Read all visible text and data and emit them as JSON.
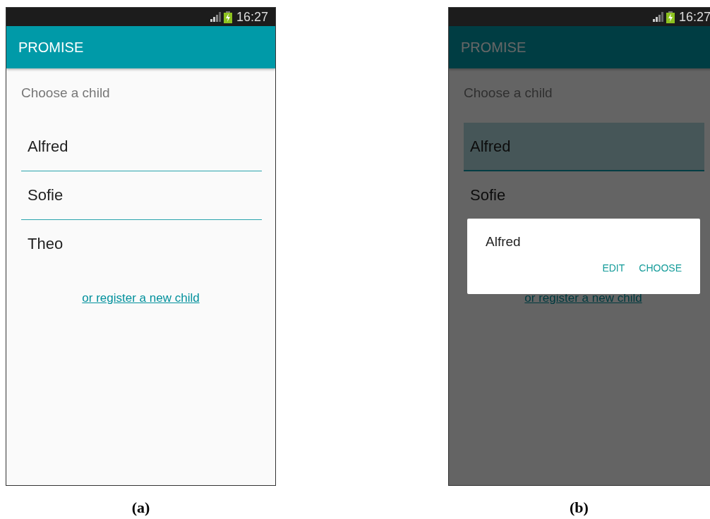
{
  "screens": [
    {
      "caption": "(a)",
      "status_bar": {
        "time": "16:27"
      },
      "app_bar": {
        "title": "PROMISE"
      },
      "prompt": "Choose a child",
      "children": [
        {
          "name": "Alfred",
          "selected": false
        },
        {
          "name": "Sofie",
          "selected": false
        },
        {
          "name": "Theo",
          "selected": false
        }
      ],
      "register_link": "or register a new child"
    },
    {
      "caption": "(b)",
      "status_bar": {
        "time": "16:27"
      },
      "app_bar": {
        "title": "PROMISE"
      },
      "prompt": "Choose a child",
      "children": [
        {
          "name": "Alfred",
          "selected": true
        },
        {
          "name": "Sofie",
          "selected": false
        }
      ],
      "register_link": "or register a new child",
      "dialog": {
        "title": "Alfred",
        "buttons": [
          "EDIT",
          "CHOOSE"
        ]
      }
    }
  ]
}
